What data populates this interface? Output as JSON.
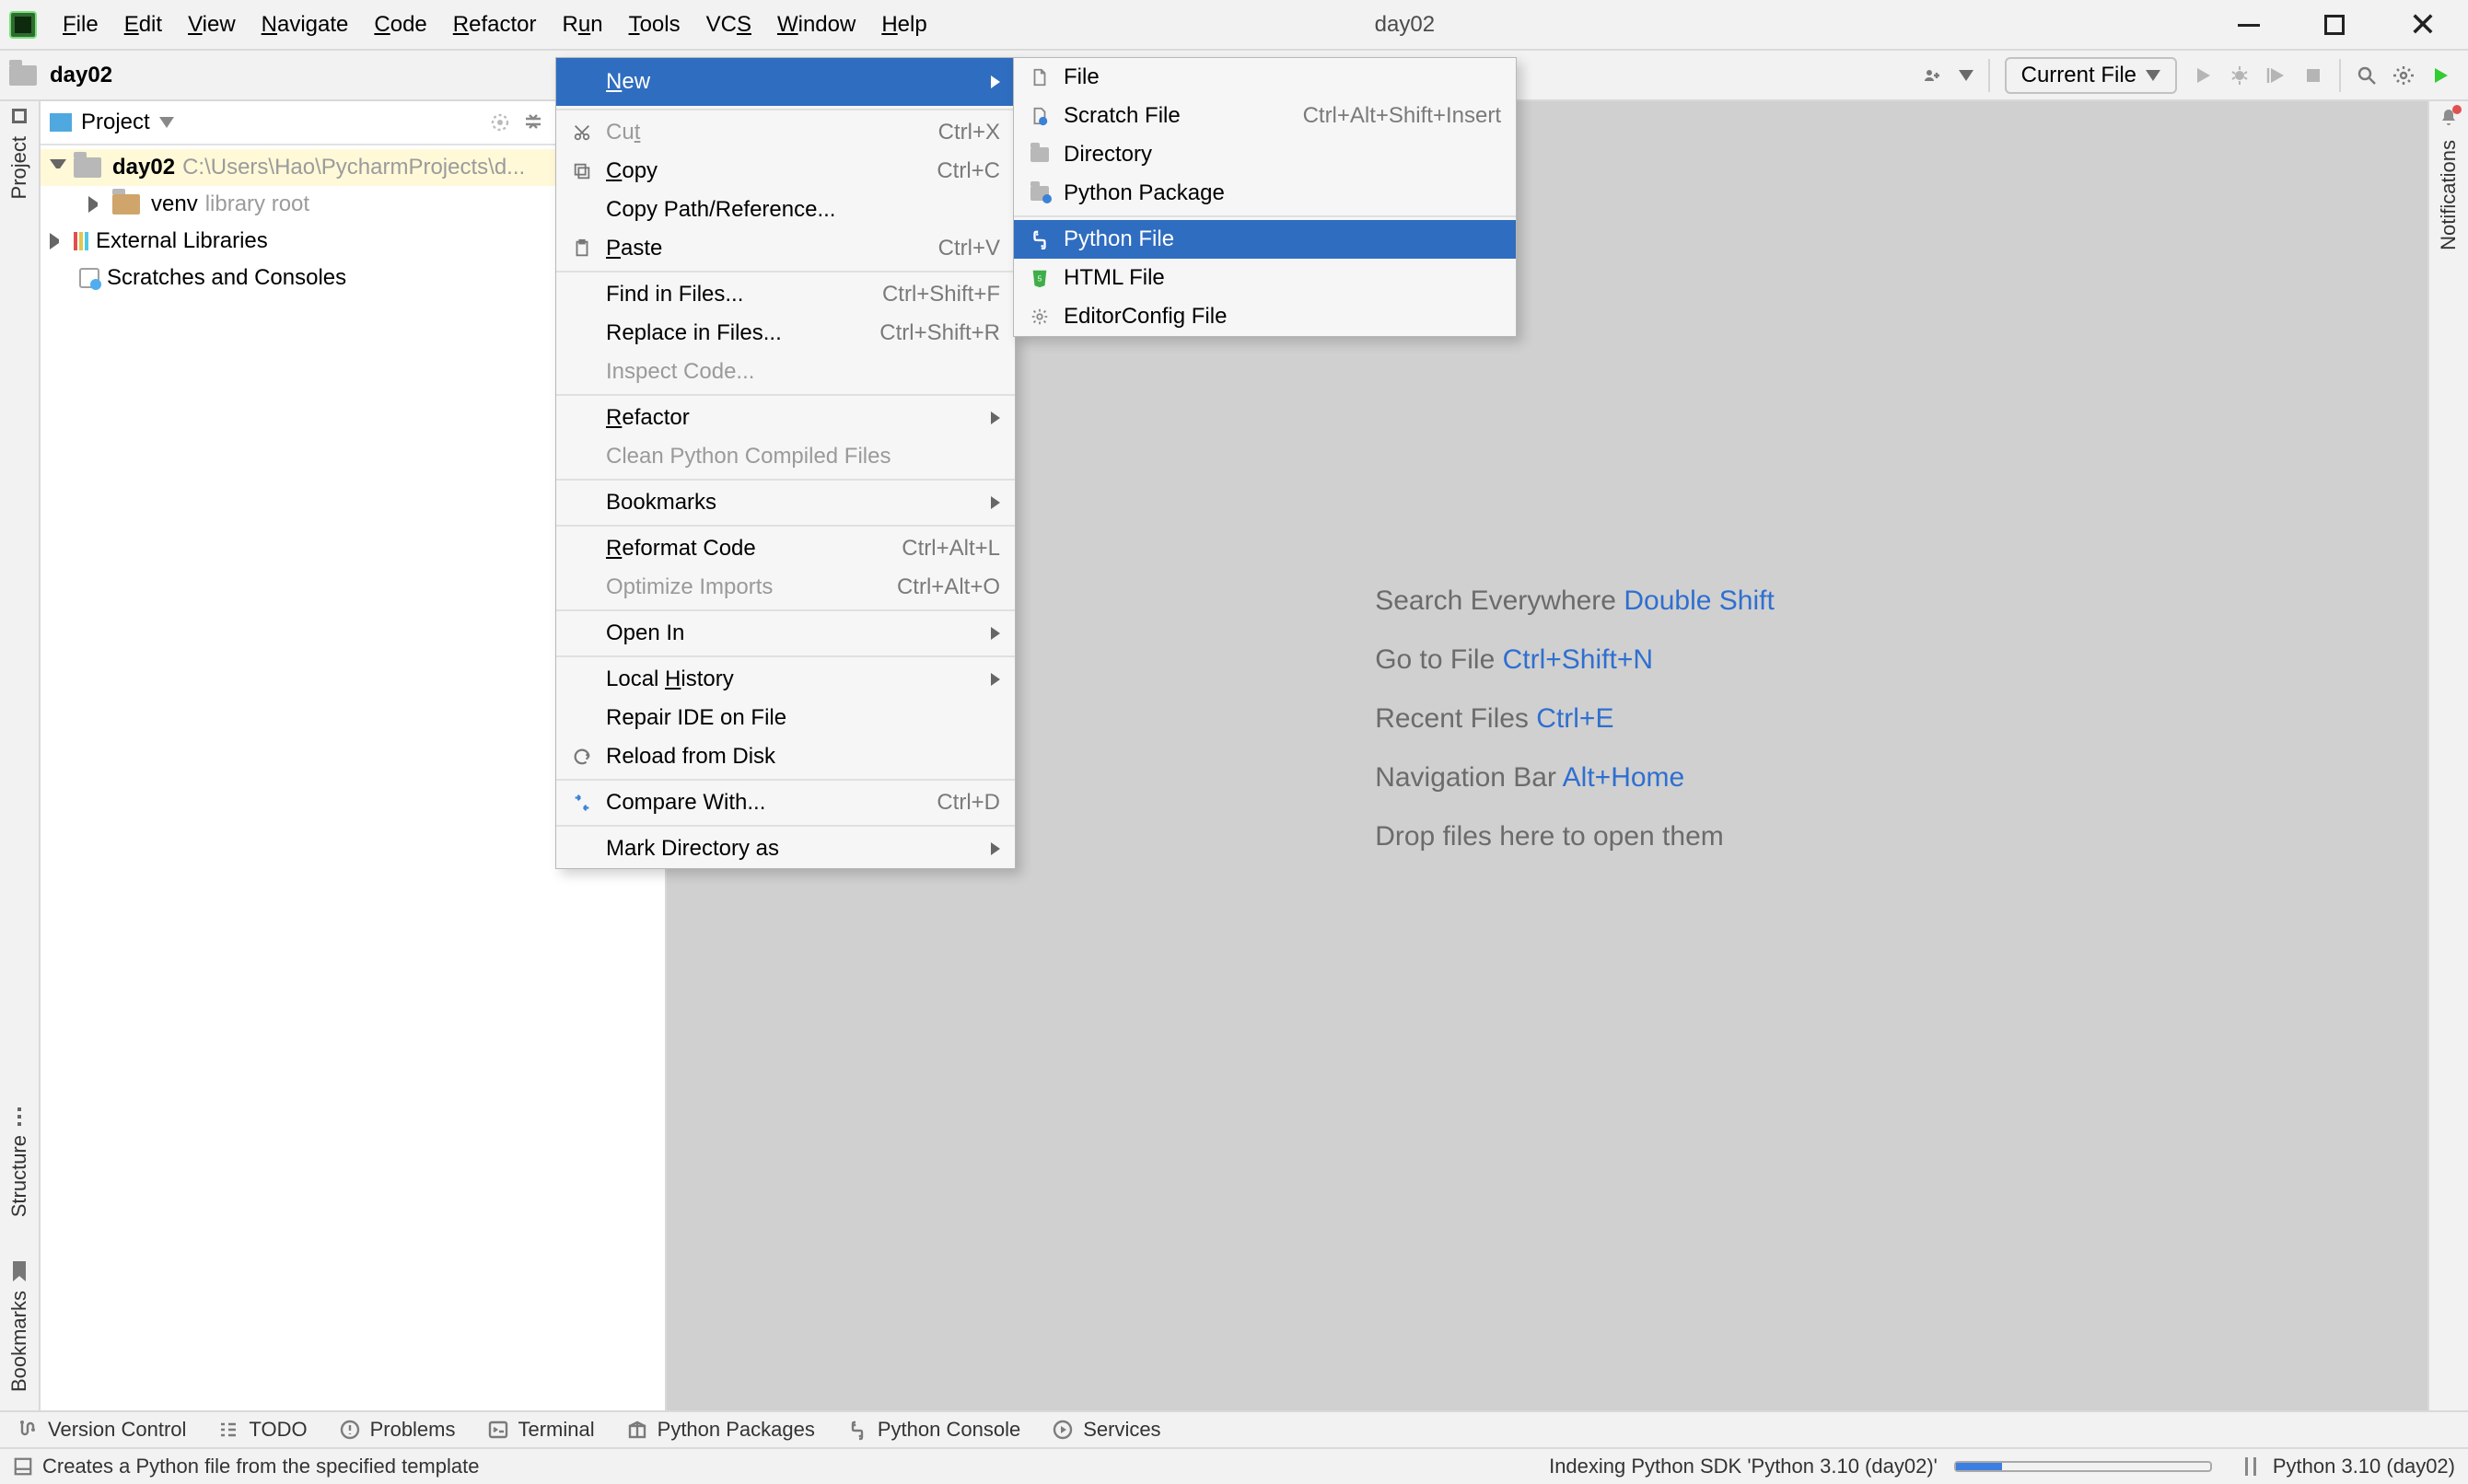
{
  "window": {
    "title": "day02"
  },
  "menubar": [
    "File",
    "Edit",
    "View",
    "Navigate",
    "Code",
    "Refactor",
    "Run",
    "Tools",
    "VCS",
    "Window",
    "Help"
  ],
  "nav": {
    "project": "day02",
    "run_config": "Current File"
  },
  "left_rail": {
    "project": "Project",
    "structure": "Structure",
    "bookmarks": "Bookmarks"
  },
  "right_rail": {
    "notifications": "Notifications"
  },
  "project_panel": {
    "title": "Project",
    "root": {
      "name": "day02",
      "path": "C:\\Users\\Hao\\PycharmProjects\\d..."
    },
    "venv": {
      "name": "venv",
      "tag": "library root"
    },
    "ext": "External Libraries",
    "scratch": "Scratches and Consoles"
  },
  "tips": [
    {
      "text": "Search Everywhere",
      "kb": "Double Shift"
    },
    {
      "text": "Go to File",
      "kb": "Ctrl+Shift+N"
    },
    {
      "text": "Recent Files",
      "kb": "Ctrl+E"
    },
    {
      "text": "Navigation Bar",
      "kb": "Alt+Home"
    },
    {
      "text": "Drop files here to open them",
      "kb": ""
    }
  ],
  "context_menu": {
    "items": [
      {
        "label": "New",
        "submenu": true,
        "hi": true,
        "mn": "N"
      },
      {
        "sep": true
      },
      {
        "label": "Cut",
        "shortcut": "Ctrl+X",
        "icon": "cut",
        "disabled": true,
        "mn": "t"
      },
      {
        "label": "Copy",
        "shortcut": "Ctrl+C",
        "icon": "copy",
        "mn": "C"
      },
      {
        "label": "Copy Path/Reference...",
        "mn": ""
      },
      {
        "label": "Paste",
        "shortcut": "Ctrl+V",
        "icon": "paste",
        "mn": "P"
      },
      {
        "sep": true
      },
      {
        "label": "Find in Files...",
        "shortcut": "Ctrl+Shift+F"
      },
      {
        "label": "Replace in Files...",
        "shortcut": "Ctrl+Shift+R"
      },
      {
        "label": "Inspect Code...",
        "disabled": true
      },
      {
        "sep": true
      },
      {
        "label": "Refactor",
        "submenu": true,
        "mn": "R"
      },
      {
        "label": "Clean Python Compiled Files",
        "disabled": true
      },
      {
        "sep": true
      },
      {
        "label": "Bookmarks",
        "submenu": true
      },
      {
        "sep": true
      },
      {
        "label": "Reformat Code",
        "shortcut": "Ctrl+Alt+L",
        "mn": "R"
      },
      {
        "label": "Optimize Imports",
        "shortcut": "Ctrl+Alt+O",
        "disabled": true
      },
      {
        "sep": true
      },
      {
        "label": "Open In",
        "submenu": true
      },
      {
        "sep": true
      },
      {
        "label": "Local History",
        "submenu": true,
        "mn": "H"
      },
      {
        "label": "Repair IDE on File"
      },
      {
        "label": "Reload from Disk",
        "icon": "reload"
      },
      {
        "sep": true
      },
      {
        "label": "Compare With...",
        "shortcut": "Ctrl+D",
        "icon": "compare"
      },
      {
        "sep": true
      },
      {
        "label": "Mark Directory as",
        "submenu": true
      }
    ]
  },
  "new_submenu": {
    "items": [
      {
        "label": "File",
        "shortcut": "",
        "icon": "file"
      },
      {
        "label": "Scratch File",
        "shortcut": "Ctrl+Alt+Shift+Insert",
        "icon": "scratch"
      },
      {
        "label": "Directory",
        "icon": "dir"
      },
      {
        "label": "Python Package",
        "icon": "pkg"
      },
      {
        "sep": true
      },
      {
        "label": "Python File",
        "icon": "py",
        "hi": true
      },
      {
        "label": "HTML File",
        "icon": "html"
      },
      {
        "label": "EditorConfig File",
        "icon": "editorconfig"
      }
    ]
  },
  "bottom_tools": [
    "Version Control",
    "TODO",
    "Problems",
    "Terminal",
    "Python Packages",
    "Python Console",
    "Services"
  ],
  "status": {
    "hint": "Creates a Python file from the specified template",
    "indexing": "Indexing Python SDK 'Python 3.10 (day02)'",
    "interpreter": "Python 3.10 (day02)"
  }
}
